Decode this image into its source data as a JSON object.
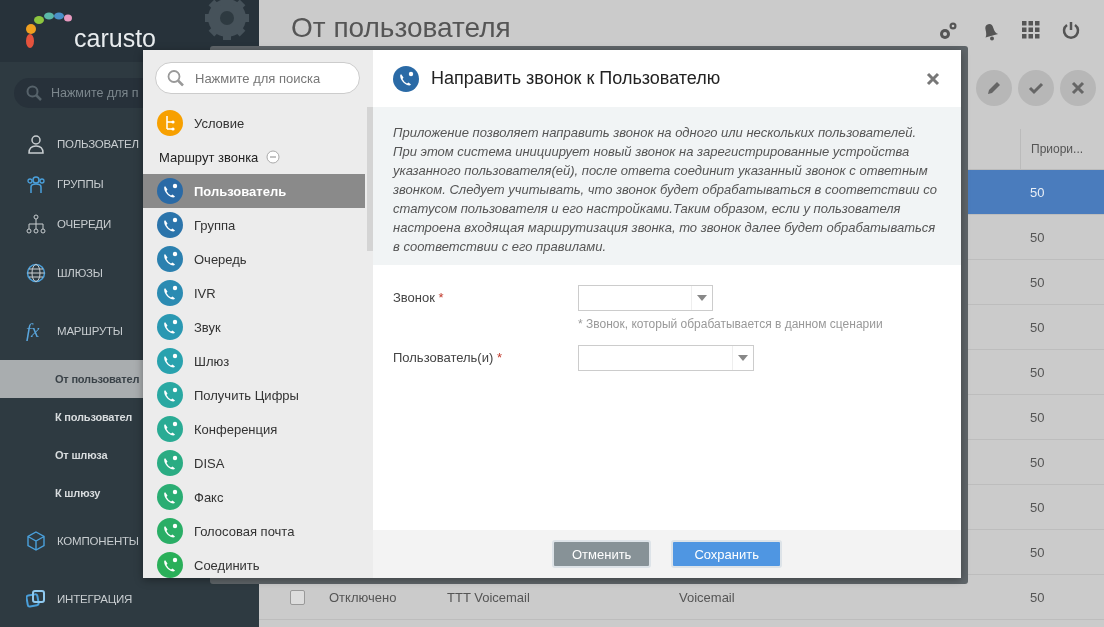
{
  "app": {
    "logo": "carusto",
    "search": {
      "placeholder": "Нажмите для п"
    },
    "nav": [
      {
        "kind": "user",
        "label": "ПОЛЬЗОВАТЕЛ"
      },
      {
        "kind": "group",
        "label": "ГРУППЫ"
      },
      {
        "kind": "queue",
        "label": "ОЧЕРЕДИ"
      },
      {
        "kind": "globe",
        "label": "ШЛЮЗЫ"
      },
      {
        "kind": "fx",
        "icon_text": "fx",
        "label": "МАРШРУТЫ",
        "children": [
          {
            "label": "От пользовател",
            "selected": true
          },
          {
            "label": "К пользовател",
            "selected": false
          },
          {
            "label": "От шлюза",
            "selected": false
          },
          {
            "label": "К шлюзу",
            "selected": false
          }
        ]
      },
      {
        "kind": "cube",
        "label": "КОМПОНЕНТЫ"
      },
      {
        "kind": "integration",
        "label": "ИНТЕГРАЦИЯ"
      }
    ],
    "page_title": "От пользователя",
    "table": {
      "priority_header": "Приори...",
      "rows": [
        {
          "selected": true,
          "priority": "50"
        },
        {
          "selected": false,
          "priority": "50"
        },
        {
          "selected": false,
          "priority": "50"
        },
        {
          "selected": false,
          "priority": "50"
        },
        {
          "selected": false,
          "priority": "50"
        },
        {
          "selected": false,
          "priority": "50"
        },
        {
          "selected": false,
          "priority": "50"
        },
        {
          "selected": false,
          "priority": "50"
        },
        {
          "selected": false,
          "priority": "50"
        },
        {
          "selected": false,
          "checked": false,
          "status": "Отключено",
          "name": "TTT Voicemail",
          "type": "Voicemail",
          "priority": "50"
        }
      ]
    }
  },
  "dialog": {
    "search": {
      "placeholder": "Нажмите для поиска"
    },
    "top_items": [
      {
        "label": "Условие",
        "color": "#f7a000",
        "selected": false
      }
    ],
    "group": {
      "title": "Маршрут звонка",
      "expanded": true,
      "items": [
        {
          "label": "Пользователь",
          "color": "#2a6aa6",
          "selected": true
        },
        {
          "label": "Группа",
          "color": "#2b74ab",
          "selected": false
        },
        {
          "label": "Очередь",
          "color": "#2b80af",
          "selected": false
        },
        {
          "label": "IVR",
          "color": "#2b8bb2",
          "selected": false
        },
        {
          "label": "Звук",
          "color": "#2a98b2",
          "selected": false
        },
        {
          "label": "Шлюз",
          "color": "#29a2ae",
          "selected": false
        },
        {
          "label": "Получить Цифры",
          "color": "#29a8a2",
          "selected": false
        },
        {
          "label": "Конференция",
          "color": "#2aab94",
          "selected": false
        },
        {
          "label": "DISA",
          "color": "#2aac83",
          "selected": false
        },
        {
          "label": "Факс",
          "color": "#2aad73",
          "selected": false
        },
        {
          "label": "Голосовая почта",
          "color": "#2aae66",
          "selected": false
        },
        {
          "label": "Соединить",
          "color": "#2aaf59",
          "selected": false
        }
      ]
    },
    "title": "Направить звонок к Пользователю",
    "description": "Приложение позволяет направить звонок на одного или нескольких пользователей. При этом система инициирует новый звонок на зарегистрированные устройства указанного пользователя(ей), после ответа соединит указанный звонок с ответным звонком. Следует учитывать, что звонок будет обрабатываться в соответствии со статусом пользователя и его настройками.Таким образом, если у пользователя настроена входящая маршрутизация звонка, то звонок далее будет обрабатываться в соответствии с его правилами.",
    "fields": [
      {
        "label": "Звонок",
        "required_mark": "*",
        "help": "* Звонок, который обрабатывается в данном сценарии"
      },
      {
        "label": "Пользователь(и)",
        "required_mark": "*"
      }
    ],
    "buttons": [
      {
        "kind": "cancel",
        "label": "Отменить"
      },
      {
        "kind": "save",
        "label": "Сохранить"
      }
    ]
  }
}
